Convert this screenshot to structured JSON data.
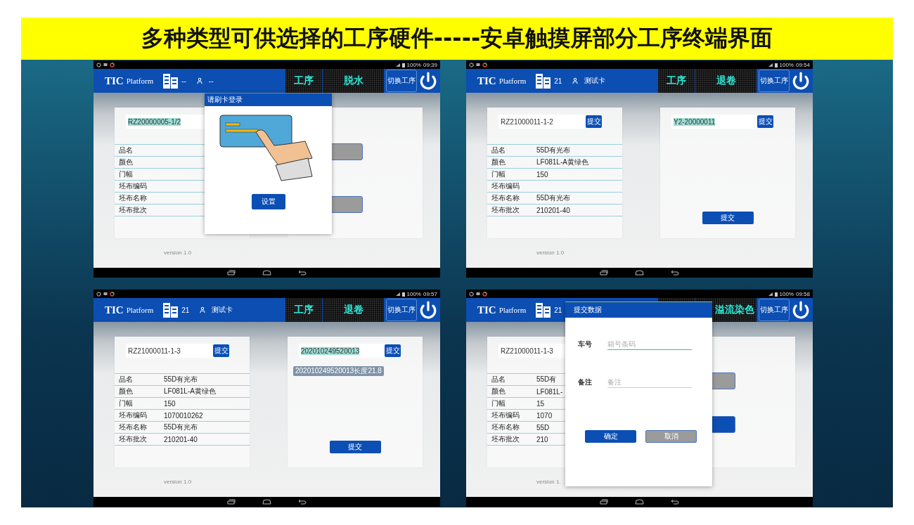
{
  "title": "多种类型可供选择的工序硬件-----安卓触摸屏部分工序终端界面",
  "screens": [
    {
      "status": {
        "battery": "100%",
        "time": "09:39"
      },
      "header": {
        "brand": "TIC",
        "brand_sub": "Platform",
        "building": "--",
        "user": "--",
        "process_label": "工序",
        "process_value": "脱水",
        "switch_button": "切换工序"
      },
      "left": {
        "input": {
          "value": "RZ20000005-1/2",
          "highlighted": true
        },
        "rows": [
          {
            "label": "品名"
          },
          {
            "label": "颜色"
          },
          {
            "label": "门幅"
          },
          {
            "label": "坯布编码"
          },
          {
            "label": "坯布名称"
          },
          {
            "label": "坯布批次"
          }
        ]
      },
      "right": {
        "kind": "actions",
        "buttons": [
          {
            "kind": "gray"
          },
          {
            "kind": "gray"
          }
        ]
      },
      "version": "version 1.0",
      "dialog": {
        "kind": "card",
        "title": "请刷卡登录",
        "button": "设置"
      }
    },
    {
      "status": {
        "battery": "100%",
        "time": "09:54"
      },
      "header": {
        "brand": "TIC",
        "brand_sub": "Platform",
        "building": "21",
        "user": "测试卡",
        "process_label": "工序",
        "process_value": "退卷",
        "switch_button": "切换工序"
      },
      "left": {
        "input": {
          "value": "RZ21000011-1-2",
          "highlighted": false
        },
        "submit": "提交",
        "rows": [
          {
            "label": "品名",
            "value": "55D有光布"
          },
          {
            "label": "颜色",
            "value": "LF081L-A黄绿色"
          },
          {
            "label": "门幅",
            "value": "150"
          },
          {
            "label": "坯布编码"
          },
          {
            "label": "坯布名称",
            "value": "55D有光布"
          },
          {
            "label": "坯布批次",
            "value": "210201-40"
          }
        ]
      },
      "right": {
        "kind": "scan",
        "input": {
          "value": "Y2-20000011",
          "highlighted": true
        },
        "submit": "提交",
        "button": "提交"
      },
      "version": "version 1.0"
    },
    {
      "status": {
        "battery": "100%",
        "time": "09:57"
      },
      "header": {
        "brand": "TIC",
        "brand_sub": "Platform",
        "building": "21",
        "user": "测试卡",
        "process_label": "工序",
        "process_value": "退卷",
        "switch_button": "切换工序"
      },
      "left": {
        "input": {
          "value": "RZ21000011-1-3",
          "highlighted": false
        },
        "submit": "提交",
        "rows": [
          {
            "label": "品名",
            "value": "55D有光布"
          },
          {
            "label": "颜色",
            "value": "LF081L-A黄绿色"
          },
          {
            "label": "门幅",
            "value": "150"
          },
          {
            "label": "坯布编码",
            "value": "1070010262"
          },
          {
            "label": "坯布名称",
            "value": "55D有光布"
          },
          {
            "label": "坯布批次",
            "value": "210201-40"
          }
        ]
      },
      "right": {
        "kind": "scan",
        "input": {
          "value": "202010249520013",
          "highlighted": true
        },
        "submit": "提交",
        "chip": "202010249520013长度21.8",
        "button": "提交"
      },
      "version": "version 1.0"
    },
    {
      "status": {
        "battery": "100%",
        "time": "09:58"
      },
      "header": {
        "brand": "TIC",
        "brand_sub": "Platform",
        "building": "21",
        "process_value": "溢流染色",
        "switch_button": "切换工序"
      },
      "left": {
        "input": {
          "value": "RZ21000011-1-3",
          "highlighted": false
        },
        "rows": [
          {
            "label": "品名",
            "value": "55D有"
          },
          {
            "label": "颜色",
            "value": "LF081L-"
          },
          {
            "label": "门幅",
            "value": "15"
          },
          {
            "label": "坯布编码",
            "value": "1070"
          },
          {
            "label": "坯布名称",
            "value": "55D"
          },
          {
            "label": "坯布批次",
            "value": "210"
          }
        ]
      },
      "right": {
        "kind": "actions",
        "buttons": [
          {
            "kind": "gray"
          },
          {
            "kind": "blue"
          }
        ]
      },
      "version": "version 1.",
      "dialog": {
        "kind": "form",
        "title": "提交数据",
        "fields": [
          {
            "label": "车号",
            "placeholder": "箱号条码",
            "focused": true
          },
          {
            "label": "备注",
            "placeholder": "备注",
            "focused": false
          }
        ],
        "buttons": [
          {
            "label": "确定",
            "kind": "primary"
          },
          {
            "label": "取消",
            "kind": "secondary"
          }
        ]
      }
    }
  ]
}
